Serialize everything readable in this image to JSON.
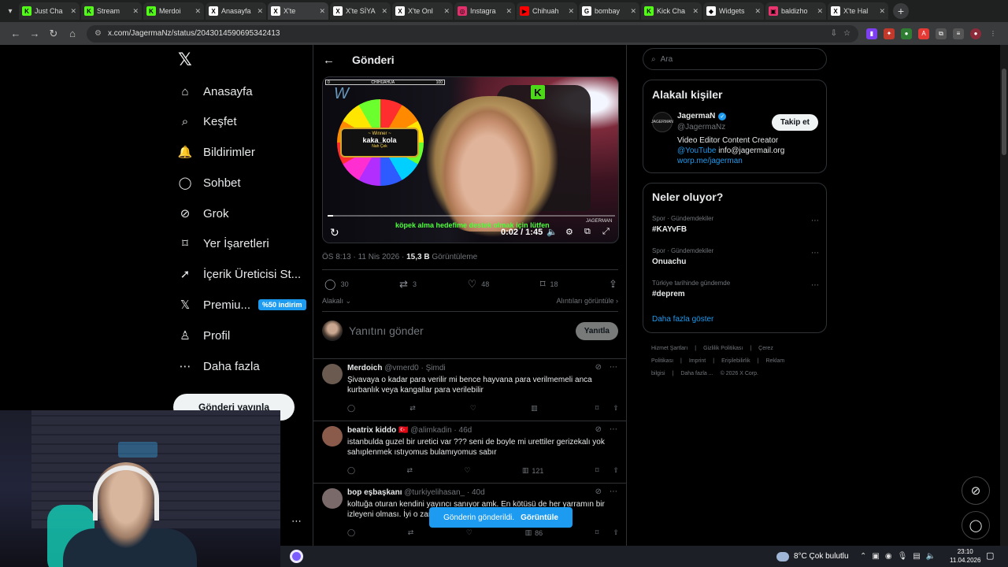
{
  "browser": {
    "tabs": [
      {
        "label": "Just Cha",
        "fav": "K",
        "color": "#53fc18"
      },
      {
        "label": "Stream",
        "fav": "K",
        "color": "#53fc18"
      },
      {
        "label": "Merdoi",
        "fav": "K",
        "color": "#53fc18"
      },
      {
        "label": "Anasayfa",
        "fav": "X",
        "color": "#ffffff"
      },
      {
        "label": "X'te",
        "fav": "X",
        "color": "#ffffff"
      },
      {
        "label": "X'te SİYA",
        "fav": "X",
        "color": "#ffffff"
      },
      {
        "label": "X'te Onl",
        "fav": "X",
        "color": "#ffffff"
      },
      {
        "label": "Instagra",
        "fav": "◎",
        "color": "#e1306c"
      },
      {
        "label": "Chihuah",
        "fav": "▶",
        "color": "#ff0000"
      },
      {
        "label": "bombay",
        "fav": "G",
        "color": "#ffffff"
      },
      {
        "label": "Kick Cha",
        "fav": "K",
        "color": "#53fc18"
      },
      {
        "label": "Widgets",
        "fav": "◆",
        "color": "#ffffff"
      },
      {
        "label": "baldizho",
        "fav": "▣",
        "color": "#e9356f"
      },
      {
        "label": "X'te Hal",
        "fav": "X",
        "color": "#ffffff"
      }
    ],
    "url": "x.com/JagermaNz/status/2043014590695342413"
  },
  "nav": {
    "items": [
      {
        "label": "Anasayfa",
        "icon": "⌂"
      },
      {
        "label": "Keşfet",
        "icon": "⌕"
      },
      {
        "label": "Bildirimler",
        "icon": "🔔"
      },
      {
        "label": "Sohbet",
        "icon": "◯"
      },
      {
        "label": "Grok",
        "icon": "⊘"
      },
      {
        "label": "Yer İşaretleri",
        "icon": "⌑"
      },
      {
        "label": "İçerik Üreticisi St...",
        "icon": "➚"
      },
      {
        "label": "Premiu...",
        "icon": "𝕏"
      },
      {
        "label": "Profil",
        "icon": "♙"
      },
      {
        "label": "Daha fazla",
        "icon": "⋯"
      }
    ],
    "premium_badge": "%50 indirim",
    "post_button": "Gönderi yayınla"
  },
  "main": {
    "title": "Gönderi",
    "video": {
      "time": "0:02 / 1:45",
      "progress": 0.02,
      "subtitle": "köpek alma hedefime destek olmak için lütfen",
      "wheel_top_label": "CHIHUAHUA",
      "wheel_top_value": "100",
      "winner_heading": "~ Winner ~",
      "winner_name": "kaka_kola",
      "winner_sub": "Nah Çek",
      "watermark": "JAGERMAN"
    },
    "meta": {
      "time": "ÖS 8:13 · 11 Nis 2026 · ",
      "views": "15,3 B",
      "views_label": " Görüntüleme"
    },
    "actions": {
      "replies": "30",
      "reposts": "3",
      "likes": "48",
      "bookmarks": "18"
    },
    "related": {
      "left": "Alakalı",
      "right": "Alıntıları görüntüle"
    },
    "reply_placeholder": "Yanıtını gönder",
    "reply_button": "Yanıtla",
    "comments": [
      {
        "name": "Merdoich",
        "handle": "@vmerd0 · Şimdi",
        "flag": "",
        "text": "Şivavaya o kadar para verilir mi bence hayvana para verilmemeli anca kurbanlık veya kangallar para verilebilir",
        "views": "",
        "avatar": "#6b5a50"
      },
      {
        "name": "beatrix kiddo",
        "handle": "@alimkadin · 46d",
        "flag": "🇹🇷",
        "text": "istanbulda guzel bir uretici var ???  seni de boyle mi urettiler gerizekalı yok sahıplenmek ıstıyomus bulamıyomus sabır",
        "views": "121",
        "avatar": "#8a5a4a"
      },
      {
        "name": "bop eşbaşkanı",
        "handle": "@turkiyelihasan_ · 40d",
        "flag": "",
        "text": "koltuğa oturan kendini yayıncı sanıyor amk. En kötüsü de her yarramın bir izleyeni olması. İyi o zaman",
        "views": "86",
        "avatar": "#7a6a6a"
      }
    ],
    "toast": {
      "text": "Gönderin gönderildi.",
      "action": "Görüntüle"
    }
  },
  "right": {
    "search_placeholder": "Ara",
    "related_title": "Alakalı kişiler",
    "person": {
      "avatar_text": "JAGERMAN",
      "name": "JagermaN",
      "handle": "@JagermaNz",
      "follow": "Takip et",
      "bio1": "Video Editor Content Creator",
      "bio_link": "@YouTube",
      "bio_email": " info@jagermail.org",
      "bio_url": "worp.me/jagerman"
    },
    "trends_title": "Neler oluyor?",
    "trends": [
      {
        "category": "Spor · Gündemdekiler",
        "title": "#KAYvFB"
      },
      {
        "category": "Spor · Gündemdekiler",
        "title": "Onuachu"
      },
      {
        "category": "Türkiye tarihinde gündemde",
        "title": "#deprem"
      }
    ],
    "show_more": "Daha fazla göster",
    "footer": [
      "Hizmet Şartları",
      "|",
      "Gizlilik Politikası",
      "|",
      "Çerez Politikası",
      "|",
      "Imprint",
      "|",
      "Erişilebilirlik",
      "|",
      "Reklam bilgisi",
      "|",
      "Daha fazla ...",
      "© 2026 X Corp."
    ]
  },
  "taskbar": {
    "weather": "8°C  Çok bulutlu",
    "time": "23:10",
    "date": "11.04.2026"
  }
}
